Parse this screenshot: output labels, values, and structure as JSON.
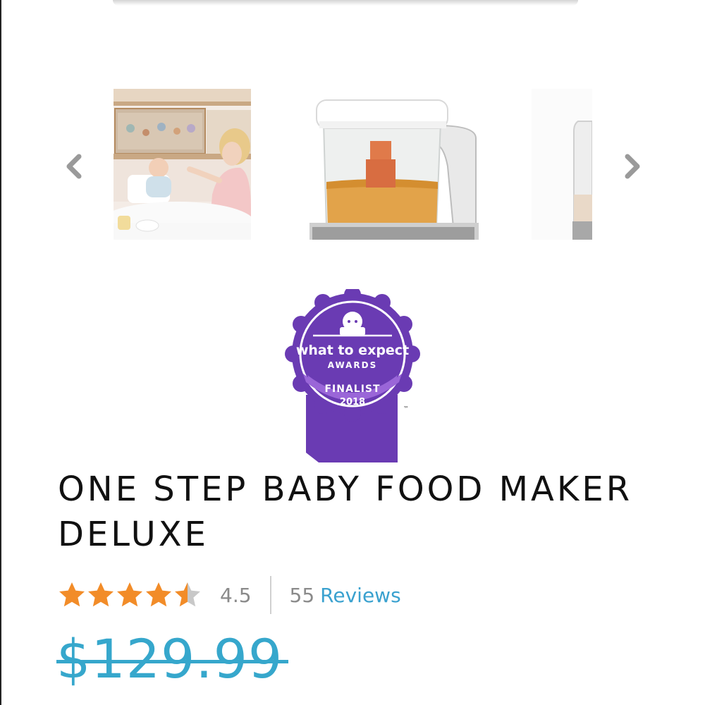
{
  "carousel": {
    "prev_icon": "chevron-left-icon",
    "next_icon": "chevron-right-icon",
    "images": [
      {
        "name": "mother-feeding-baby-photo"
      },
      {
        "name": "baby-food-maker-product-photo"
      },
      {
        "name": "baby-food-maker-partial-photo"
      }
    ]
  },
  "badge": {
    "line1": "what to expect",
    "line2": "AWARDS",
    "line3": "FINALIST",
    "line4": "2018",
    "tm": "™",
    "color": "#6a3bb3",
    "accent": "#9a66d8"
  },
  "product": {
    "title": "ONE STEP BABY FOOD MAKER DELUXE",
    "rating": 4.5,
    "rating_text": "4.5",
    "review_count": "55",
    "reviews_label": "Reviews",
    "price": "$129.99"
  },
  "colors": {
    "star": "#f28c28",
    "star_empty": "#c8c8c8",
    "link": "#3aa1cf",
    "price": "#36a7cc"
  }
}
